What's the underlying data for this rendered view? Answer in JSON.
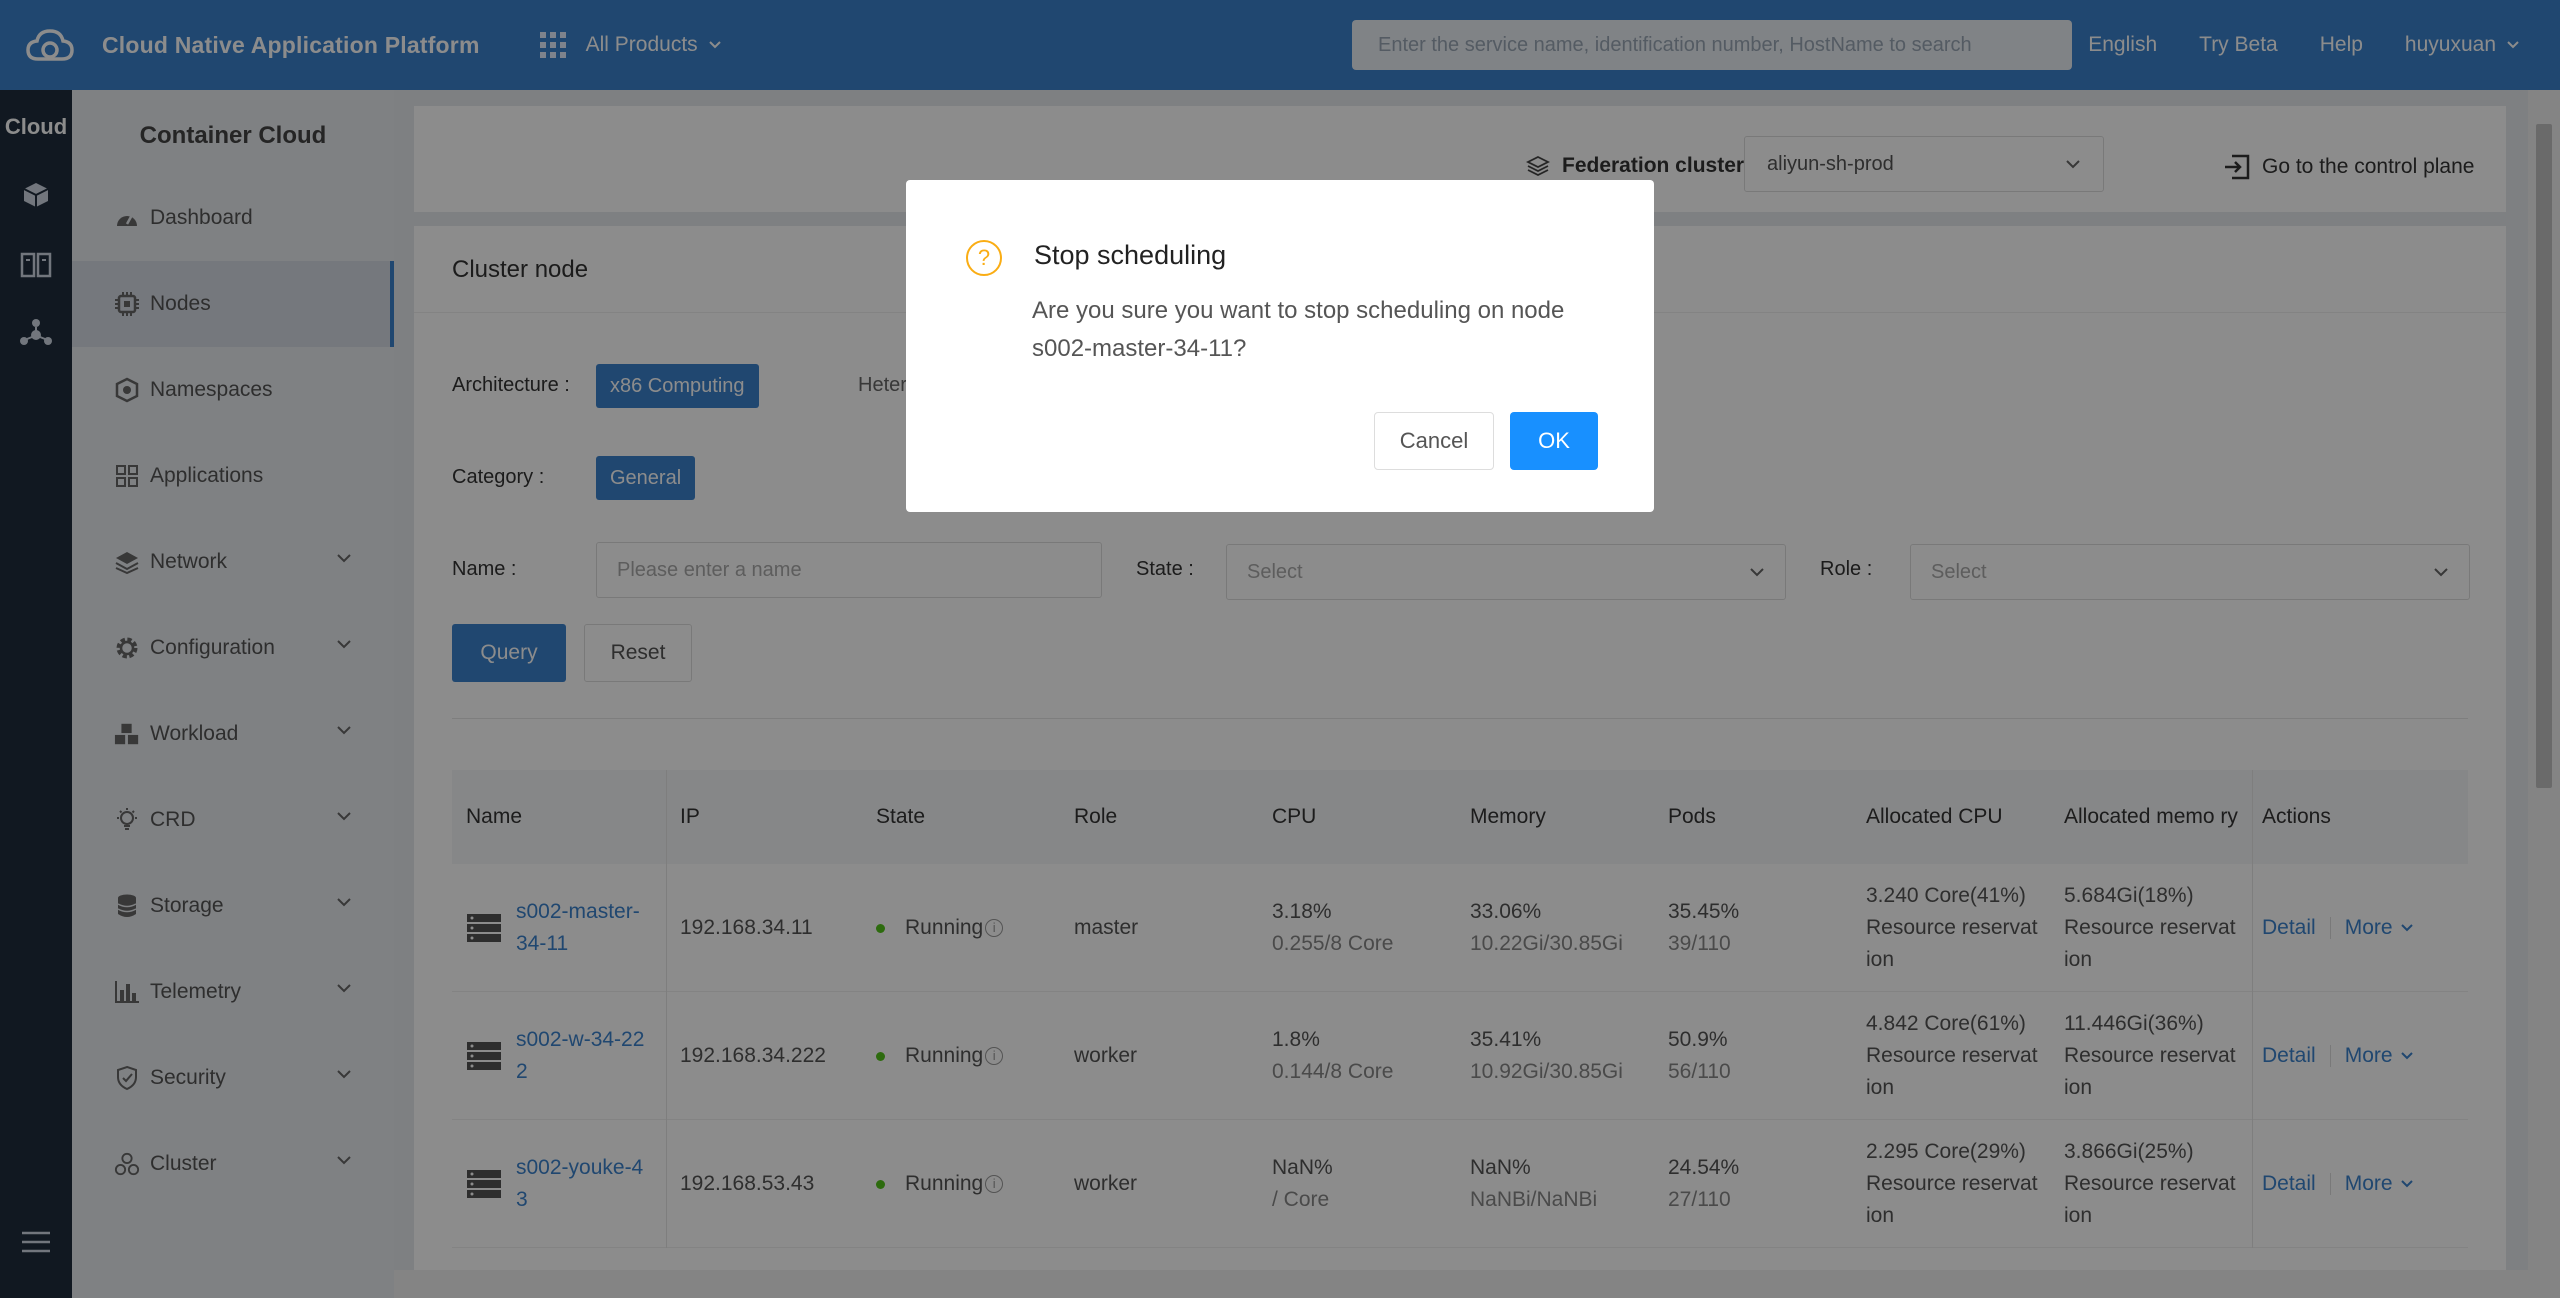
{
  "header": {
    "app_title": "Cloud Native Application Platform",
    "all_products": "All Products",
    "search_placeholder": "Enter the service name, identification number, HostName to search",
    "links": [
      "English",
      "Try Beta",
      "Help"
    ],
    "user": "huyuxuan"
  },
  "leftstrip": {
    "label": "Cloud"
  },
  "sidebar": {
    "title": "Container Cloud",
    "items": [
      {
        "label": "Dashboard",
        "icon": "dashboard-icon"
      },
      {
        "label": "Nodes",
        "icon": "chip-icon"
      },
      {
        "label": "Namespaces",
        "icon": "namespace-icon"
      },
      {
        "label": "Applications",
        "icon": "apps-icon"
      },
      {
        "label": "Network",
        "icon": "layers-icon"
      },
      {
        "label": "Configuration",
        "icon": "gear-icon"
      },
      {
        "label": "Workload",
        "icon": "cubes-icon"
      },
      {
        "label": "CRD",
        "icon": "bulb-icon"
      },
      {
        "label": "Storage",
        "icon": "database-icon"
      },
      {
        "label": "Telemetry",
        "icon": "bar-chart-icon"
      },
      {
        "label": "Security",
        "icon": "shield-icon"
      },
      {
        "label": "Cluster",
        "icon": "cluster-icon"
      }
    ]
  },
  "federation": {
    "label": "Federation cluster",
    "selected": "aliyun-sh-prod",
    "control_plane": "Go to the control plane"
  },
  "card": {
    "title": "Cluster node",
    "architecture_label": "Architecture :",
    "architecture_selected": "x86 Computing",
    "architecture_other": "Hetero",
    "category_label": "Category :",
    "category_selected": "General",
    "name_label": "Name :",
    "name_placeholder": "Please enter a name",
    "state_label": "State :",
    "state_placeholder": "Select",
    "role_label": "Role :",
    "role_placeholder": "Select",
    "query": "Query",
    "reset": "Reset"
  },
  "table": {
    "headers": [
      "Name",
      "IP",
      "State",
      "Role",
      "CPU",
      "Memory",
      "Pods",
      "Allocated CPU",
      "Allocated memo ry",
      "Actions"
    ],
    "rows": [
      {
        "name": "s002-master-34-11",
        "ip": "192.168.34.11",
        "state": "Running",
        "role": "master",
        "cpu": "3.18%",
        "cpu_sub": "0.255/8 Core",
        "mem": "33.06%",
        "mem_sub": "10.22Gi/30.85Gi",
        "pods": "35.45%",
        "pods_sub": "39/110",
        "alloc_cpu": "3.240 Core(41%)",
        "alloc_mem": "5.684Gi(18%)",
        "reserve": "Resource reservat ion",
        "detail": "Detail",
        "more": "More"
      },
      {
        "name": "s002-w-34-222",
        "ip": "192.168.34.222",
        "state": "Running",
        "role": "worker",
        "cpu": "1.8%",
        "cpu_sub": "0.144/8 Core",
        "mem": "35.41%",
        "mem_sub": "10.92Gi/30.85Gi",
        "pods": "50.9%",
        "pods_sub": "56/110",
        "alloc_cpu": "4.842 Core(61%)",
        "alloc_mem": "11.446Gi(36%)",
        "reserve": "Resource reservat ion",
        "detail": "Detail",
        "more": "More"
      },
      {
        "name": "s002-youke-43",
        "ip": "192.168.53.43",
        "state": "Running",
        "role": "worker",
        "cpu": "NaN%",
        "cpu_sub": "/ Core",
        "mem": "NaN%",
        "mem_sub": "NaNBi/NaNBi",
        "pods": "24.54%",
        "pods_sub": "27/110",
        "alloc_cpu": "2.295 Core(29%)",
        "alloc_mem": "3.866Gi(25%)",
        "reserve": "Resource reservat ion",
        "detail": "Detail",
        "more": "More"
      }
    ]
  },
  "modal": {
    "title": "Stop scheduling",
    "body": "Are you sure you want to stop scheduling on node s002-master-34-11?",
    "cancel": "Cancel",
    "ok": "OK"
  },
  "colors": {
    "brand": "#3b82cc",
    "ok_button": "#1890ff",
    "warning": "#faad14",
    "running": "#52c41a"
  }
}
